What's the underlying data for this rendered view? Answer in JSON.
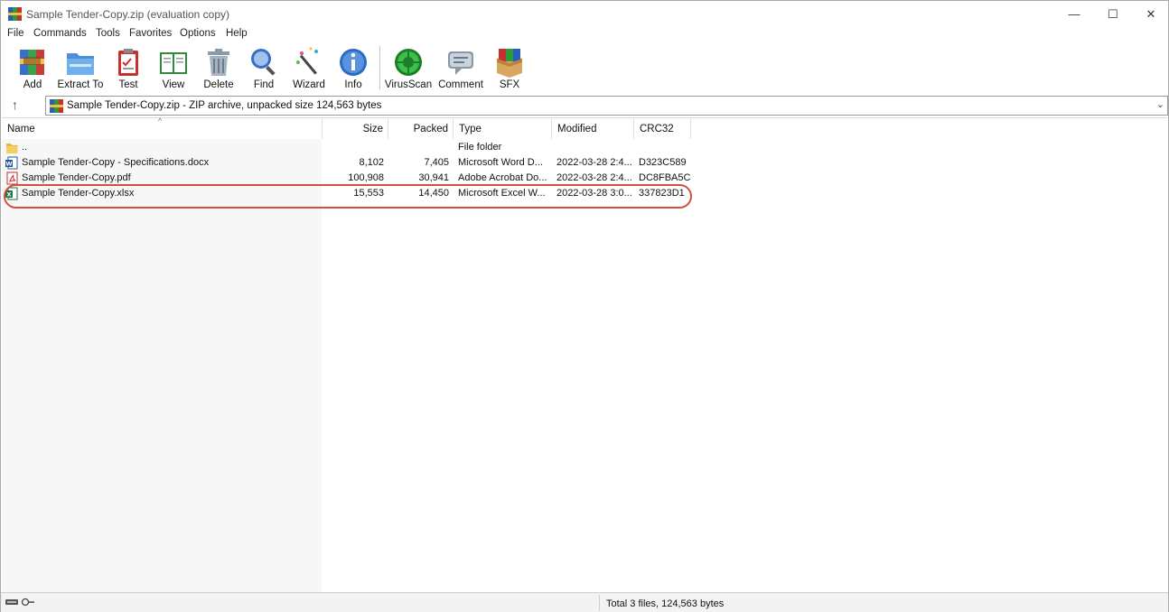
{
  "window": {
    "title": "Sample Tender-Copy.zip (evaluation copy)",
    "minimize_glyph": "—",
    "maximize_glyph": "☐",
    "close_glyph": "✕"
  },
  "menu": [
    "File",
    "Commands",
    "Tools",
    "Favorites",
    "Options",
    "Help"
  ],
  "toolbar": {
    "add": "Add",
    "extract_to": "Extract To",
    "test": "Test",
    "view": "View",
    "delete": "Delete",
    "find": "Find",
    "wizard": "Wizard",
    "info": "Info",
    "virusscan": "VirusScan",
    "comment": "Comment",
    "sfx": "SFX"
  },
  "address": {
    "up_glyph": "↑",
    "text": "Sample Tender-Copy.zip - ZIP archive, unpacked size 124,563 bytes",
    "dropdown_glyph": "⌄"
  },
  "columns": {
    "name": "Name",
    "size": "Size",
    "packed": "Packed",
    "type": "Type",
    "modified": "Modified",
    "crc32": "CRC32"
  },
  "files": [
    {
      "name": "..",
      "size": "",
      "packed": "",
      "type": "File folder",
      "modified": "",
      "crc32": "",
      "icon": "folder-icon"
    },
    {
      "name": "Sample Tender-Copy - Specifications.docx",
      "size": "8,102",
      "packed": "7,405",
      "type": "Microsoft Word D...",
      "modified": "2022-03-28 2:4...",
      "crc32": "D323C589",
      "icon": "word-doc-icon"
    },
    {
      "name": "Sample Tender-Copy.pdf",
      "size": "100,908",
      "packed": "30,941",
      "type": "Adobe Acrobat Do...",
      "modified": "2022-03-28 2:4...",
      "crc32": "DC8FBA5C",
      "icon": "pdf-icon"
    },
    {
      "name": "Sample Tender-Copy.xlsx",
      "size": "15,553",
      "packed": "14,450",
      "type": "Microsoft Excel W...",
      "modified": "2022-03-28 3:0...",
      "crc32": "337823D1",
      "icon": "excel-icon"
    }
  ],
  "status": {
    "text": "Total 3 files, 124,563 bytes"
  },
  "colors": {
    "highlight_ring": "#d0503c",
    "name_column_bg": "#f7f7f7"
  }
}
